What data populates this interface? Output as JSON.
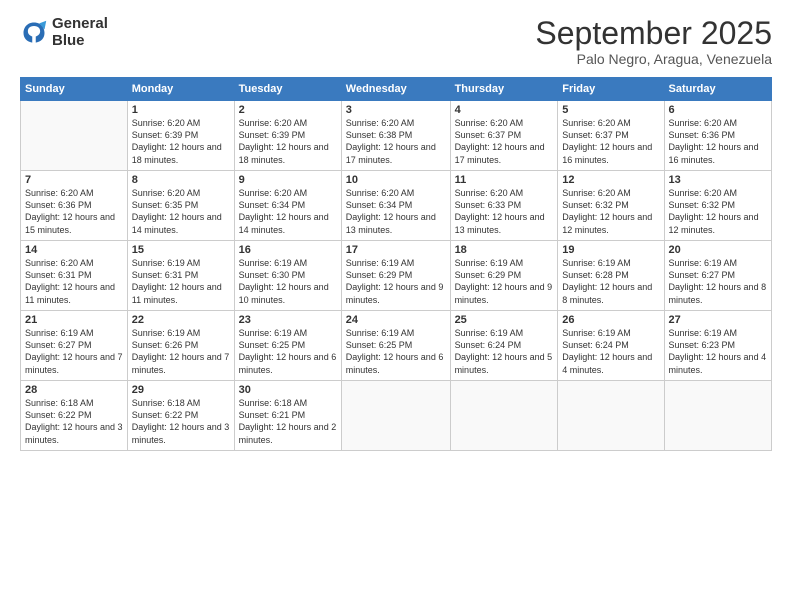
{
  "header": {
    "logo_line1": "General",
    "logo_line2": "Blue",
    "month": "September 2025",
    "location": "Palo Negro, Aragua, Venezuela"
  },
  "weekdays": [
    "Sunday",
    "Monday",
    "Tuesday",
    "Wednesday",
    "Thursday",
    "Friday",
    "Saturday"
  ],
  "weeks": [
    [
      {
        "day": "",
        "empty": true
      },
      {
        "day": "1",
        "rise": "6:20 AM",
        "set": "6:39 PM",
        "daylight": "12 hours and 18 minutes."
      },
      {
        "day": "2",
        "rise": "6:20 AM",
        "set": "6:39 PM",
        "daylight": "12 hours and 18 minutes."
      },
      {
        "day": "3",
        "rise": "6:20 AM",
        "set": "6:38 PM",
        "daylight": "12 hours and 17 minutes."
      },
      {
        "day": "4",
        "rise": "6:20 AM",
        "set": "6:37 PM",
        "daylight": "12 hours and 17 minutes."
      },
      {
        "day": "5",
        "rise": "6:20 AM",
        "set": "6:37 PM",
        "daylight": "12 hours and 16 minutes."
      },
      {
        "day": "6",
        "rise": "6:20 AM",
        "set": "6:36 PM",
        "daylight": "12 hours and 16 minutes."
      }
    ],
    [
      {
        "day": "7",
        "rise": "6:20 AM",
        "set": "6:36 PM",
        "daylight": "12 hours and 15 minutes."
      },
      {
        "day": "8",
        "rise": "6:20 AM",
        "set": "6:35 PM",
        "daylight": "12 hours and 14 minutes."
      },
      {
        "day": "9",
        "rise": "6:20 AM",
        "set": "6:34 PM",
        "daylight": "12 hours and 14 minutes."
      },
      {
        "day": "10",
        "rise": "6:20 AM",
        "set": "6:34 PM",
        "daylight": "12 hours and 13 minutes."
      },
      {
        "day": "11",
        "rise": "6:20 AM",
        "set": "6:33 PM",
        "daylight": "12 hours and 13 minutes."
      },
      {
        "day": "12",
        "rise": "6:20 AM",
        "set": "6:32 PM",
        "daylight": "12 hours and 12 minutes."
      },
      {
        "day": "13",
        "rise": "6:20 AM",
        "set": "6:32 PM",
        "daylight": "12 hours and 12 minutes."
      }
    ],
    [
      {
        "day": "14",
        "rise": "6:20 AM",
        "set": "6:31 PM",
        "daylight": "12 hours and 11 minutes."
      },
      {
        "day": "15",
        "rise": "6:19 AM",
        "set": "6:31 PM",
        "daylight": "12 hours and 11 minutes."
      },
      {
        "day": "16",
        "rise": "6:19 AM",
        "set": "6:30 PM",
        "daylight": "12 hours and 10 minutes."
      },
      {
        "day": "17",
        "rise": "6:19 AM",
        "set": "6:29 PM",
        "daylight": "12 hours and 9 minutes."
      },
      {
        "day": "18",
        "rise": "6:19 AM",
        "set": "6:29 PM",
        "daylight": "12 hours and 9 minutes."
      },
      {
        "day": "19",
        "rise": "6:19 AM",
        "set": "6:28 PM",
        "daylight": "12 hours and 8 minutes."
      },
      {
        "day": "20",
        "rise": "6:19 AM",
        "set": "6:27 PM",
        "daylight": "12 hours and 8 minutes."
      }
    ],
    [
      {
        "day": "21",
        "rise": "6:19 AM",
        "set": "6:27 PM",
        "daylight": "12 hours and 7 minutes."
      },
      {
        "day": "22",
        "rise": "6:19 AM",
        "set": "6:26 PM",
        "daylight": "12 hours and 7 minutes."
      },
      {
        "day": "23",
        "rise": "6:19 AM",
        "set": "6:25 PM",
        "daylight": "12 hours and 6 minutes."
      },
      {
        "day": "24",
        "rise": "6:19 AM",
        "set": "6:25 PM",
        "daylight": "12 hours and 6 minutes."
      },
      {
        "day": "25",
        "rise": "6:19 AM",
        "set": "6:24 PM",
        "daylight": "12 hours and 5 minutes."
      },
      {
        "day": "26",
        "rise": "6:19 AM",
        "set": "6:24 PM",
        "daylight": "12 hours and 4 minutes."
      },
      {
        "day": "27",
        "rise": "6:19 AM",
        "set": "6:23 PM",
        "daylight": "12 hours and 4 minutes."
      }
    ],
    [
      {
        "day": "28",
        "rise": "6:18 AM",
        "set": "6:22 PM",
        "daylight": "12 hours and 3 minutes."
      },
      {
        "day": "29",
        "rise": "6:18 AM",
        "set": "6:22 PM",
        "daylight": "12 hours and 3 minutes."
      },
      {
        "day": "30",
        "rise": "6:18 AM",
        "set": "6:21 PM",
        "daylight": "12 hours and 2 minutes."
      },
      {
        "day": "",
        "empty": true
      },
      {
        "day": "",
        "empty": true
      },
      {
        "day": "",
        "empty": true
      },
      {
        "day": "",
        "empty": true
      }
    ]
  ]
}
